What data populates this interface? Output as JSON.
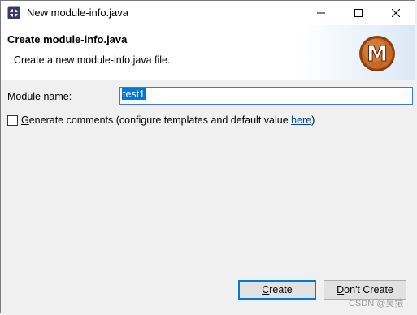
{
  "window": {
    "title": "New module-info.java",
    "controls": {
      "minimize": "minimize-icon",
      "maximize": "maximize-icon",
      "close": "close-icon"
    }
  },
  "banner": {
    "title": "Create module-info.java",
    "message": "Create a new module-info.java file.",
    "logo_letter": "M",
    "logo_color": "#b15a1c"
  },
  "form": {
    "module_name_label_pre": "",
    "module_name_label_mn": "M",
    "module_name_label_post": "odule name:",
    "module_name_value": "test1",
    "generate_checked": false,
    "generate_mn": "G",
    "generate_label": "enerate comments (configure templates and default value ",
    "generate_link": "here",
    "generate_suffix": ")"
  },
  "buttons": {
    "create_mn": "C",
    "create_rest": "reate",
    "dont_mn": "D",
    "dont_rest": "on't Create"
  },
  "watermark": "CSDN @吴猿"
}
